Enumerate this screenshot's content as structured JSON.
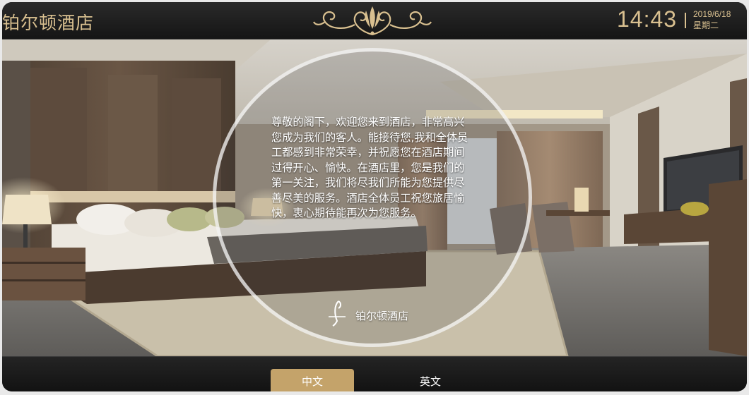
{
  "header": {
    "hotel_name": "铂尔顿酒店",
    "time": "14:43",
    "date": "2019/6/18",
    "weekday": "星期二",
    "ornament_icon": "gold-flourish-ornament"
  },
  "welcome": {
    "message": "尊敬的阁下，欢迎您来到酒店，非常高兴您成为我们的客人。能接待您,我和全体员工都感到非常荣幸，并祝愿您在酒店期间过得开心、愉快。在酒店里，您是我们的第一关注，我们将尽我们所能为您提供尽善尽美的服务。酒店全体员工祝您旅居愉快，衷心期待能再次为您服务。",
    "brand_logo_icon": "hotel-swan-logo",
    "brand_name": "铂尔顿酒店"
  },
  "language_bar": {
    "chinese_label": "中文",
    "english_label": "英文",
    "selected": "中文"
  },
  "colors": {
    "gold_accent": "#d9c090",
    "selected_button": "#c4a36a",
    "bar_background": "#1c1c1c"
  }
}
